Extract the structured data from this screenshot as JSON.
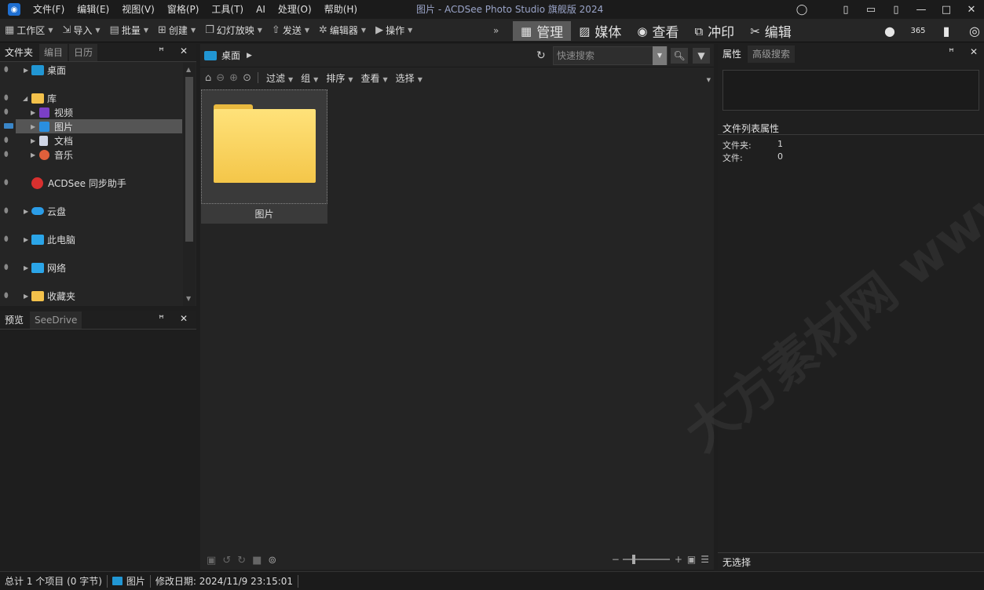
{
  "titlebar": {
    "app_icon": "acdsee-logo-icon",
    "menu": [
      "文件(F)",
      "编辑(E)",
      "视图(V)",
      "窗格(P)",
      "工具(T)",
      "AI",
      "处理(O)",
      "帮助(H)"
    ],
    "window_title": "图片 - ACDSee Photo Studio 旗舰版 2024"
  },
  "toolbar": {
    "items": [
      {
        "label": "工作区",
        "icon": "workspace-icon"
      },
      {
        "label": "导入",
        "icon": "import-icon"
      },
      {
        "label": "批量",
        "icon": "batch-icon"
      },
      {
        "label": "创建",
        "icon": "create-icon"
      },
      {
        "label": "幻灯放映",
        "icon": "slideshow-icon"
      },
      {
        "label": "发送",
        "icon": "send-icon"
      },
      {
        "label": "编辑器",
        "icon": "editor-icon"
      },
      {
        "label": "操作",
        "icon": "actions-icon"
      }
    ]
  },
  "modes": [
    {
      "label": "管理",
      "icon": "grid-icon",
      "active": true
    },
    {
      "label": "媒体",
      "icon": "media-icon"
    },
    {
      "label": "查看",
      "icon": "eye-icon"
    },
    {
      "label": "冲印",
      "icon": "develop-icon"
    },
    {
      "label": "编辑",
      "icon": "edit-tools-icon"
    }
  ],
  "mode_icons": {
    "365": "365",
    "icons": [
      "people-icon",
      "acdsee-365-icon",
      "dashboard-icon",
      "preview-eye-icon"
    ]
  },
  "left_panel": {
    "tabs": [
      "文件夹",
      "编目",
      "日历"
    ],
    "tree": [
      {
        "label": "桌面",
        "icon": "desktop-icon",
        "color": "#2196d3"
      },
      {
        "label": "库",
        "icon": "library-icon",
        "color": "#f3c14b"
      },
      {
        "label": "视频",
        "icon": "video-icon",
        "color": "#7b3fc6"
      },
      {
        "label": "图片",
        "icon": "pictures-icon",
        "color": "#2a8fe0"
      },
      {
        "label": "文档",
        "icon": "documents-icon",
        "color": "#cfd6e6"
      },
      {
        "label": "音乐",
        "icon": "music-icon",
        "color": "#e0603b"
      },
      {
        "label": "ACDSee 同步助手",
        "icon": "acdsee-sync-icon",
        "color": "#d8302f"
      },
      {
        "label": "云盘",
        "icon": "cloud-icon",
        "color": "#2b9de8"
      },
      {
        "label": "此电脑",
        "icon": "computer-icon",
        "color": "#2ba5e8"
      },
      {
        "label": "网络",
        "icon": "network-icon",
        "color": "#2ba5e8"
      },
      {
        "label": "收藏夹",
        "icon": "favorites-icon",
        "color": "#f3c14b"
      }
    ]
  },
  "preview_panel": {
    "tabs": [
      "预览",
      "SeeDrive"
    ]
  },
  "center": {
    "path_label": "桌面",
    "quicksearch_placeholder": "快速搜索",
    "filters": [
      "过滤",
      "组",
      "排序",
      "查看",
      "选择"
    ],
    "folder_name": "图片"
  },
  "right_panel": {
    "tabs": [
      "属性",
      "高级搜索"
    ],
    "section_title": "文件列表属性",
    "rows": [
      {
        "key": "文件夹:",
        "value": "1"
      },
      {
        "key": "文件:",
        "value": "0"
      }
    ],
    "bottom_label": "无选择"
  },
  "statusbar": {
    "total": "总计 1 个项目 (0 字节)",
    "folder": "图片",
    "modified": "修改日期: 2024/11/9 23:15:01"
  },
  "watermark": "大方素材网 www.dfsucai.com"
}
